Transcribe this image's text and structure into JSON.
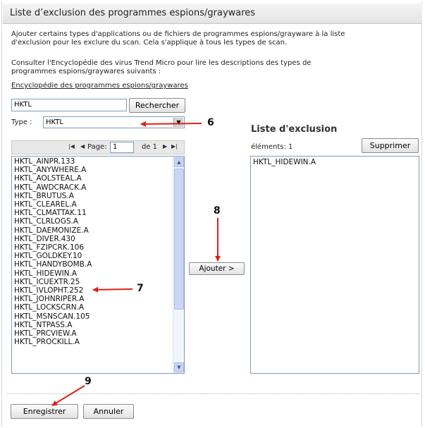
{
  "title": "Liste d’exclusion des programmes espions/graywares",
  "intro_line1": "Ajouter certains types d'applications ou de fichiers de programmes espions/grayware à la liste",
  "intro_line2": "d'exclusion pour les exclure du scan. Cela s'applique à tous les types de scan.",
  "consult_line1": "Consulter l'Encyclopédie des virus Trend Micro pour lire les descriptions des types de",
  "consult_line2": "programmes espions/graywares suivants :",
  "encyclopedia_link": "Encyclopédie des programmes espions/graywares",
  "search": {
    "value": "HKTL",
    "button": "Rechercher"
  },
  "type": {
    "label": "Type :",
    "selected": "HKTL"
  },
  "pager": {
    "page_label": "Page:",
    "page_value": "1",
    "of_label": "de 1"
  },
  "available_list": [
    "HKTL_AINPR.133",
    "HKTL_ANYWHERE.A",
    "HKTL_AOLSTEAL.A",
    "HKTL_AWDCRACK.A",
    "HKTL_BRUTUS.A",
    "HKTL_CLEAREL.A",
    "HKTL_CLMATTAK.11",
    "HKTL_CLRLOGS.A",
    "HKTL_DAEMONIZE.A",
    "HKTL_DIVER.430",
    "HKTL_FZIPCRK.106",
    "HKTL_GOLDKEY.10",
    "HKTL_HANDYBOMB.A",
    "HKTL_HIDEWIN.A",
    "HKTL_ICUEXTR.25",
    "HKTL_IVLOPHT.252",
    "HKTL_JOHNRIPER.A",
    "HKTL_LOCKSCRN.A",
    "HKTL_MSNSCAN.105",
    "HKTL_NTPASS.A",
    "HKTL_PRCVIEW.A",
    "HKTL_PROCKILL.A"
  ],
  "add_button": "Ajouter >",
  "exclusion": {
    "heading": "Liste d'exclusion",
    "count_label": "éléments: 1",
    "remove_button": "Supprimer",
    "items": [
      "HKTL_HIDEWIN.A"
    ]
  },
  "save_button": "Enregistrer",
  "cancel_button": "Annuler",
  "annotations": [
    "6",
    "7",
    "8",
    "9"
  ],
  "colors": {
    "arrow": "#e0201a",
    "input_border": "#7f9db9",
    "scrollbar": "#c7d6f5"
  }
}
